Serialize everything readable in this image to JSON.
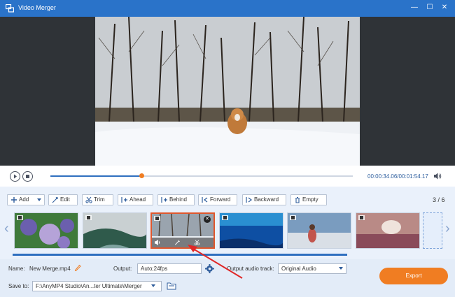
{
  "window": {
    "title": "Video Merger",
    "controls": [
      "minimize-icon",
      "maximize-icon",
      "close-icon"
    ],
    "accent_color": "#2a73c9"
  },
  "playback": {
    "time_current": "00:00:34.06",
    "time_total": "00:01:54.17",
    "progress": 0.3
  },
  "toolbar": {
    "add_label": "Add",
    "edit_label": "Edit",
    "trim_label": "Trim",
    "ahead_label": "Ahead",
    "behind_label": "Behind",
    "forward_label": "Forward",
    "backward_label": "Backward",
    "empty_label": "Empty",
    "page_indicator": "3 / 6"
  },
  "clips": [
    {
      "scene": "flowers",
      "colors": [
        "#6b5fae",
        "#3f7a3b",
        "#b5a3d8"
      ]
    },
    {
      "scene": "misty mountains",
      "colors": [
        "#c9d0d2",
        "#2f5a4b",
        "#7fa3a0"
      ]
    },
    {
      "scene": "winter trees",
      "colors": [
        "#e9eef3",
        "#4a4036",
        "#9aa4ae"
      ],
      "selected": true
    },
    {
      "scene": "underwater",
      "colors": [
        "#0e4fa3",
        "#2a8fd1",
        "#0a2f6a"
      ]
    },
    {
      "scene": "girl running",
      "colors": [
        "#7a9cbf",
        "#d9dfe6",
        "#c2554d"
      ]
    },
    {
      "scene": "crafts",
      "colors": [
        "#b98a86",
        "#8a4b5a",
        "#efe3dc"
      ]
    }
  ],
  "bottom": {
    "name_label": "Name:",
    "name_value": "New Merge.mp4",
    "output_label": "Output:",
    "output_value": "Auto;24fps",
    "audio_label": "Output audio track:",
    "audio_value": "Original Audio",
    "save_label": "Save to:",
    "save_value": "F:\\AnyMP4 Studio\\An...ter Ultimate\\Merger",
    "export_label": "Export"
  }
}
